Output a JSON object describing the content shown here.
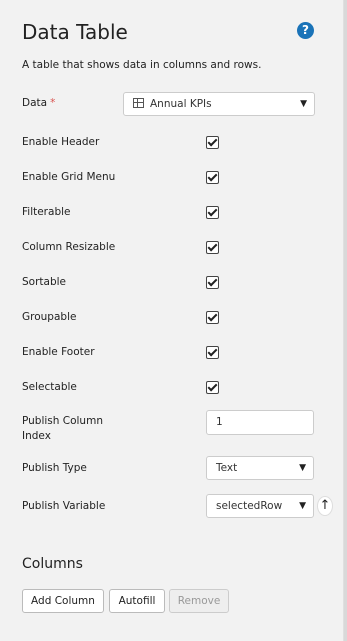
{
  "panel": {
    "title": "Data Table",
    "description": "A table that shows data in columns and rows.",
    "help_icon": "?"
  },
  "data_field": {
    "label": "Data",
    "required_mark": "*",
    "value": "Annual KPIs",
    "icon": "table-grid-icon"
  },
  "options": [
    {
      "label": "Enable Header",
      "checked": true
    },
    {
      "label": "Enable Grid Menu",
      "checked": true
    },
    {
      "label": "Filterable",
      "checked": true
    },
    {
      "label": "Column Resizable",
      "checked": true
    },
    {
      "label": "Sortable",
      "checked": true
    },
    {
      "label": "Groupable",
      "checked": true
    },
    {
      "label": "Enable Footer",
      "checked": true
    },
    {
      "label": "Selectable",
      "checked": true
    }
  ],
  "publish_column_index": {
    "label_line1": "Publish Column",
    "label_line2": "Index",
    "value": "1"
  },
  "publish_type": {
    "label": "Publish Type",
    "value": "Text"
  },
  "publish_variable": {
    "label": "Publish Variable",
    "value": "selectedRow"
  },
  "columns": {
    "title": "Columns",
    "add_label": "Add Column",
    "autofill_label": "Autofill",
    "remove_label": "Remove"
  },
  "colors": {
    "accent": "#1a73b8",
    "required": "#d9534f",
    "background": "#f2f2f2"
  }
}
